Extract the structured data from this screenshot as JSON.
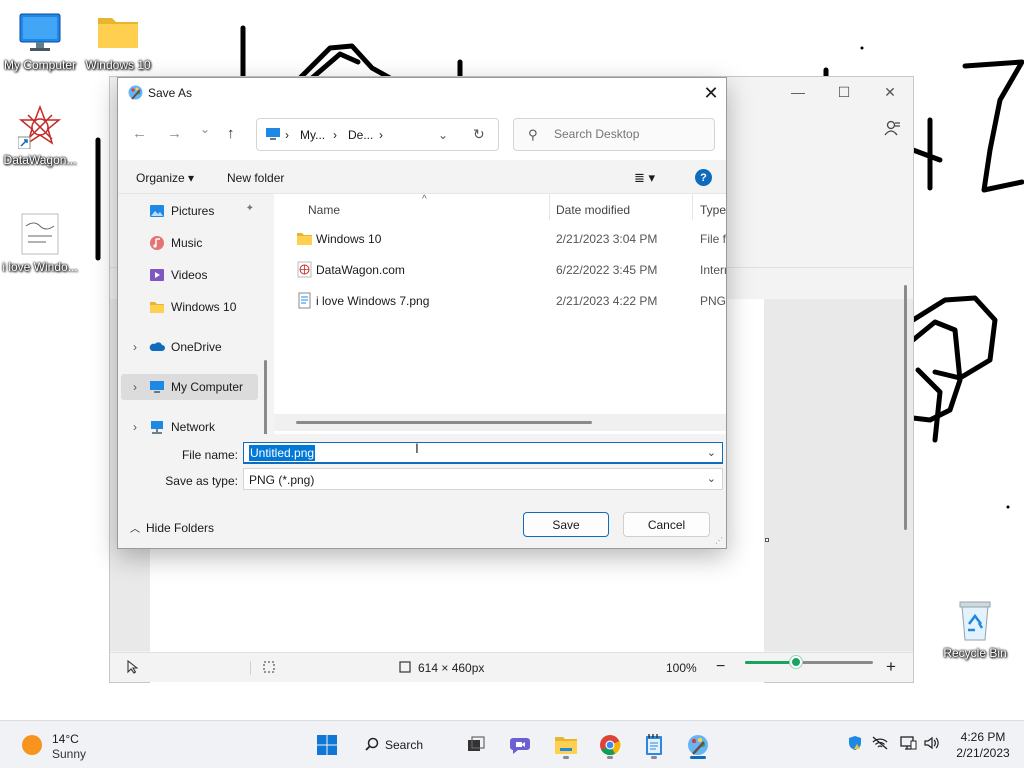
{
  "desktop": {
    "icons": [
      {
        "label": "My Computer",
        "icon": "monitor-icon"
      },
      {
        "label": "Windows 10",
        "icon": "folder-icon"
      },
      {
        "label": "DataWagon...",
        "icon": "datawagon-shortcut-icon"
      },
      {
        "label": "i love Windo...",
        "icon": "png-image-icon"
      },
      {
        "label": "Recycle Bin",
        "icon": "recycle-bin-icon"
      }
    ]
  },
  "paint": {
    "caption": {
      "minimize": "—",
      "maximize": "☐",
      "close": "✕"
    },
    "status": {
      "canvas_size": "614 × 460px",
      "zoom": "100%",
      "zoom_level": 0.4
    }
  },
  "dialog": {
    "title": "Save As",
    "close": "✕",
    "nav": {
      "back": "←",
      "forward": "→",
      "recent": "⌄",
      "up": "↑"
    },
    "address": {
      "seg1": "My...",
      "seg2": "De...",
      "sep": "›"
    },
    "search_placeholder": "Search Desktop",
    "commands": {
      "organize": "Organize ▾",
      "new_folder": "New folder",
      "view": "≣ ▾",
      "help": "?"
    },
    "sidebar": [
      {
        "label": "Pictures",
        "icon": "pictures-icon",
        "pinned": "📌"
      },
      {
        "label": "Music",
        "icon": "music-icon"
      },
      {
        "label": "Videos",
        "icon": "videos-icon"
      },
      {
        "label": "Windows 10",
        "icon": "folder-icon"
      },
      {
        "label": "OneDrive",
        "icon": "onedrive-icon",
        "expander": "›"
      },
      {
        "label": "My Computer",
        "icon": "computer-icon",
        "expander": "›"
      },
      {
        "label": "Network",
        "icon": "network-icon",
        "expander": "›"
      }
    ],
    "columns": {
      "name": "Name",
      "date": "Date modified",
      "type": "Type"
    },
    "files": [
      {
        "name": "Windows 10",
        "date": "2/21/2023 3:04 PM",
        "type": "File fo",
        "icon": "folder-icon"
      },
      {
        "name": "DataWagon.com",
        "date": "6/22/2022 3:45 PM",
        "type": "Intern",
        "icon": "internet-shortcut-icon"
      },
      {
        "name": "i love Windows 7.png",
        "date": "2/21/2023 4:22 PM",
        "type": "PNG",
        "icon": "png-file-icon"
      }
    ],
    "filename_label": "File name:",
    "filename_value": "Untitled.png",
    "filetype_label": "Save as type:",
    "filetype_value": "PNG (*.png)",
    "hide_folders": "Hide Folders",
    "save": "Save",
    "cancel": "Cancel"
  },
  "taskbar": {
    "weather": {
      "temp": "14°C",
      "condition": "Sunny"
    },
    "search": "Search",
    "clock": {
      "time": "4:26 PM",
      "date": "2/21/2023"
    }
  },
  "colors": {
    "accent": "#0f6cbd",
    "selection": "#0078d7",
    "zoom": "#1aa260"
  }
}
